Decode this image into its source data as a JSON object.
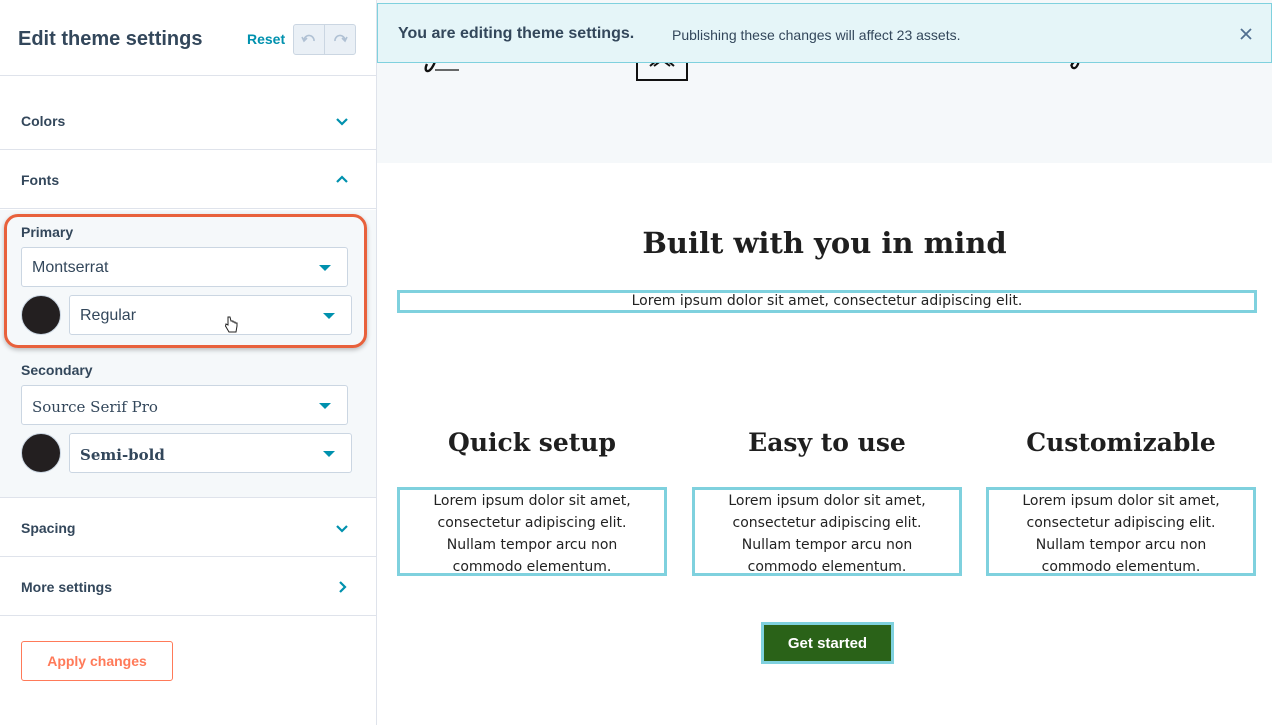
{
  "sidebar": {
    "title": "Edit theme settings",
    "reset_label": "Reset",
    "sections": {
      "colors": "Colors",
      "fonts": "Fonts",
      "spacing": "Spacing",
      "more": "More settings"
    },
    "primary": {
      "label": "Primary",
      "family": "Montserrat",
      "weight": "Regular",
      "color": "#231f20"
    },
    "secondary": {
      "label": "Secondary",
      "family": "Source Serif Pro",
      "weight": "Semi-bold",
      "color": "#231f20"
    },
    "apply_label": "Apply changes"
  },
  "banner": {
    "title": "You are editing theme settings.",
    "text": "Publishing these changes will affect 23 assets."
  },
  "preview": {
    "hero_title": "Built with you in mind",
    "hero_sub": "Lorem ipsum dolor sit amet, consectetur adipiscing elit.",
    "features": [
      {
        "title": "Quick setup",
        "body": "Lorem ipsum dolor sit amet, consectetur adipiscing elit. Nullam tempor arcu non commodo elementum."
      },
      {
        "title": "Easy to use",
        "body": "Lorem ipsum dolor sit amet, consectetur adipiscing elit. Nullam tempor arcu non commodo elementum."
      },
      {
        "title": "Customizable",
        "body": "Lorem ipsum dolor sit amet, consectetur adipiscing elit. Nullam tempor arcu non commodo elementum."
      }
    ],
    "cta_label": "Get started"
  },
  "colors": {
    "accent": "#0091ae",
    "apply": "#ff7a59",
    "highlight": "#e8613c",
    "cta": "#2a6218",
    "outline": "#7fd1de"
  }
}
